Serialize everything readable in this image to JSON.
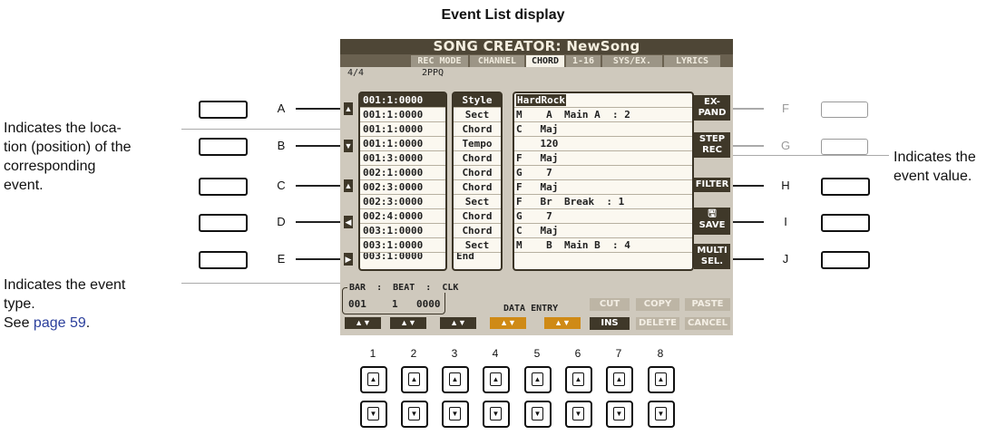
{
  "page_title": "Event List display",
  "annotations": {
    "location": "Indicates the loca-\ntion (position) of the\ncorresponding\nevent.",
    "event_value": "Indicates the\nevent value.",
    "event_type_line1": "Indicates the event",
    "event_type_line2": "type.",
    "see_prefix": "See ",
    "see_link": "page 59",
    "see_suffix": "."
  },
  "left_letters": [
    "A",
    "B",
    "C",
    "D",
    "E"
  ],
  "right_letters": [
    "F",
    "G",
    "H",
    "I",
    "J"
  ],
  "lcd": {
    "title": "SONG CREATOR: NewSong",
    "tabs": [
      "REC MODE",
      "CHANNEL",
      "CHORD",
      "1-16",
      "SYS/EX.",
      "LYRICS"
    ],
    "active_tab": "CHORD",
    "time_signature": "4/4",
    "ppq": "2PPQ",
    "events": [
      {
        "pos": "001:1:0000",
        "type": "Style",
        "root": "HardRock",
        "value": ""
      },
      {
        "pos": "001:1:0000",
        "type": "Sect",
        "root": "M",
        "value": "    A  Main A  : 2"
      },
      {
        "pos": "001:1:0000",
        "type": "Chord",
        "root": "C",
        "value": "   Maj"
      },
      {
        "pos": "001:1:0000",
        "type": "Tempo",
        "root": "",
        "value": "    120"
      },
      {
        "pos": "001:3:0000",
        "type": "Chord",
        "root": "F",
        "value": "   Maj"
      },
      {
        "pos": "002:1:0000",
        "type": "Chord",
        "root": "G",
        "value": "    7"
      },
      {
        "pos": "002:3:0000",
        "type": "Chord",
        "root": "F",
        "value": "   Maj"
      },
      {
        "pos": "002:3:0000",
        "type": "Sect",
        "root": "F",
        "value": "   Br  Break  : 1"
      },
      {
        "pos": "002:4:0000",
        "type": "Chord",
        "root": "G",
        "value": "    7"
      },
      {
        "pos": "003:1:0000",
        "type": "Chord",
        "root": "C",
        "value": "   Maj"
      },
      {
        "pos": "003:1:0000",
        "type": "Sect",
        "root": "M",
        "value": "    B  Main B  : 4"
      }
    ],
    "partial_row": {
      "pos": "003:1:0000",
      "type": "End"
    },
    "right_buttons": [
      "EX-\nPAND",
      "STEP\nREC",
      "FILTER",
      "SAVE",
      "MULTI\nSEL."
    ],
    "bottom_headers": "BAR  :  BEAT  :  CLK",
    "bar": "001",
    "beat": "1",
    "clk": "0000",
    "data_entry": "DATA ENTRY",
    "cut": "CUT",
    "copy": "COPY",
    "paste": "PASTE",
    "ins": "INS",
    "delete": "DELETE",
    "cancel": "CANCEL"
  },
  "bottom_numbers": [
    "1",
    "2",
    "3",
    "4",
    "5",
    "6",
    "7",
    "8"
  ]
}
